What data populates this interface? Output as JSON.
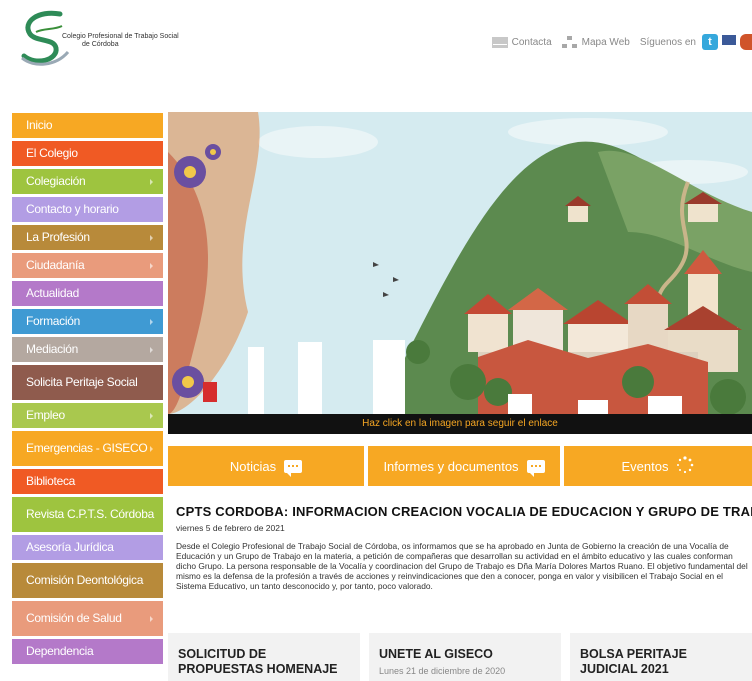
{
  "header": {
    "logo_line1": "Colegio Profesional de Trabajo Social",
    "logo_line2": "de Córdoba",
    "links": {
      "contact": "Contacta",
      "sitemap": "Mapa Web",
      "follow": "Síguenos en"
    }
  },
  "sidebar": {
    "items": [
      {
        "label": "Inicio",
        "color": "#f7a823",
        "submenu": false
      },
      {
        "label": "El Colegio",
        "color": "#f05a24",
        "submenu": false
      },
      {
        "label": "Colegiación",
        "color": "#9ec43f",
        "submenu": true
      },
      {
        "label": "Contacto y horario",
        "color": "#b29de4",
        "submenu": false
      },
      {
        "label": "La Profesión",
        "color": "#b88a3a",
        "submenu": true
      },
      {
        "label": "Ciudadanía",
        "color": "#e99b7c",
        "submenu": true
      },
      {
        "label": "Actualidad",
        "color": "#b479c9",
        "submenu": false
      },
      {
        "label": "Formación",
        "color": "#3f9ad3",
        "submenu": true
      },
      {
        "label": "Mediación",
        "color": "#b4a8a0",
        "submenu": true
      },
      {
        "label": "Solicita Peritaje Social",
        "color": "#8f5b4d",
        "submenu": false
      },
      {
        "label": "Empleo",
        "color": "#a9c84e",
        "submenu": true
      },
      {
        "label": "Emergencias - GISECO",
        "color": "#f7a823",
        "submenu": true
      },
      {
        "label": "Biblioteca",
        "color": "#f05a24",
        "submenu": false
      },
      {
        "label": "Revista C.P.T.S. Córdoba",
        "color": "#9ec43f",
        "submenu": false
      },
      {
        "label": "Asesoría Jurídica",
        "color": "#b29de4",
        "submenu": false
      },
      {
        "label": "Comisión Deontológica",
        "color": "#b88a3a",
        "submenu": false
      },
      {
        "label": "Comisión de Salud",
        "color": "#e99b7c",
        "submenu": true
      },
      {
        "label": "Dependencia",
        "color": "#b479c9",
        "submenu": false
      }
    ]
  },
  "banner": {
    "caption": "Haz click en la imagen para seguir el enlace"
  },
  "tabs": [
    {
      "label": "Noticias",
      "icon": "chat-icon"
    },
    {
      "label": "Informes y documentos",
      "icon": "chat-icon"
    },
    {
      "label": "Eventos",
      "icon": "loading-icon"
    }
  ],
  "article": {
    "title": "CPTS CORDOBA: INFORMACION CREACION VOCALIA DE EDUCACION Y GRUPO DE TRABAJO",
    "date": "viernes 5 de febrero de 2021",
    "body": "Desde el Colegio Profesional de Trabajo Social de Córdoba, os informamos que se ha aprobado en Junta de Gobierno la creación de una Vocalía de Educación y un Grupo de Trabajo en la materia, a petición de compañeras que desarrollan su actividad en el ámbito educativo y las cuales conforman dicho Grupo. La persona responsable de la Vocalía y coordinacion del Grupo de Trabajo es Dña María Dolores Martos Ruano. El objetivo fundamental del mismo es la defensa de la profesión a través de acciones y reinvindicaciones que den a conocer, ponga en valor y visibilicen el Trabajo Social en el Sistema Educativo, un tanto desconocido y, por tanto, poco valorado."
  },
  "cards": [
    {
      "title": "SOLICITUD DE PROPUESTAS HOMENAJE",
      "date": ""
    },
    {
      "title": "UNETE AL GISECO",
      "date": "Lunes 21 de diciembre de 2020"
    },
    {
      "title": "BOLSA PERITAJE JUDICIAL 2021",
      "date": ""
    }
  ]
}
